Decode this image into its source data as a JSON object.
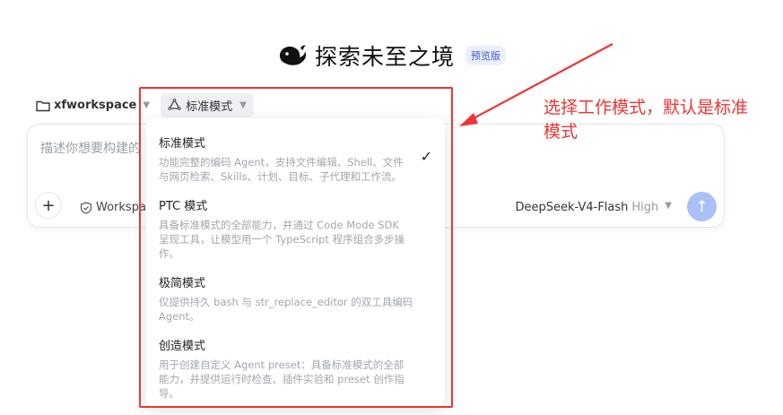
{
  "header": {
    "title": "探索未至之境",
    "badge": "预览版",
    "logo_icon": "whale-logo-icon"
  },
  "toolbar": {
    "workspace_label": "xfworkspace",
    "mode_label": "标准模式"
  },
  "composer": {
    "placeholder": "描述你想要构建的",
    "workspace_chip": "Workspa",
    "model_name": "DeepSeek-V4-Flash",
    "model_level": "High"
  },
  "mode_menu": {
    "options": [
      {
        "title": "标准模式",
        "desc_lines": [
          "功能完整的编码 Agent，支持文件编辑、Shell、文件",
          "与网页检索、Skills、计划、目标、子代理和工作流。"
        ],
        "selected": true
      },
      {
        "title": "PTC 模式",
        "desc_lines": [
          "具备标准模式的全部能力，并通过 Code Mode SDK",
          "呈现工具，让模型用一个 TypeScript 程序组合多步操",
          "作。"
        ],
        "selected": false
      },
      {
        "title": "极简模式",
        "desc_lines": [
          "仅提供持久 bash 与 str_replace_editor 的双工具编码",
          "Agent。"
        ],
        "selected": false
      },
      {
        "title": "创造模式",
        "desc_lines": [
          "用于创建自定义 Agent preset：具备标准模式的全部",
          "能力，并提供运行时检查、插件实验和 preset 创作指",
          "导。"
        ],
        "selected": false
      }
    ]
  },
  "annotation": {
    "lines": [
      "选择工作模式，默认是标准",
      "模式"
    ],
    "color": "#ef3434"
  }
}
